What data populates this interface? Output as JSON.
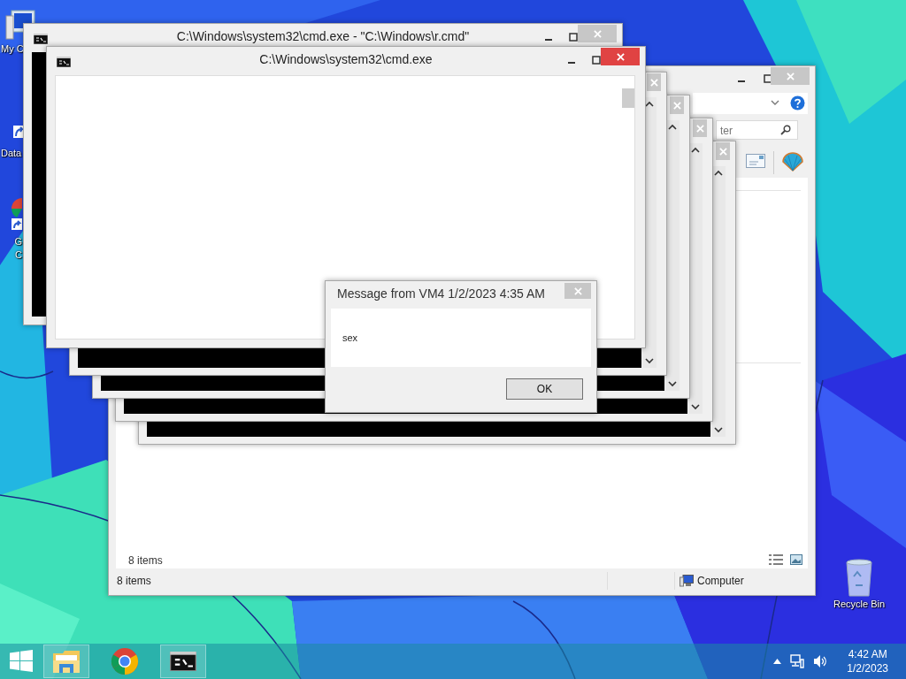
{
  "desktop_icons": [
    {
      "kind": "computer",
      "lines": [
        "My C"
      ]
    },
    {
      "kind": "shortcut",
      "lines": [
        "Data"
      ]
    },
    {
      "kind": "chrome",
      "lines": [
        "G",
        "C"
      ]
    },
    {
      "kind": "recycle",
      "lines": [
        "Recycle Bin"
      ]
    }
  ],
  "explorer": {
    "search": {
      "placeholder": "ter"
    },
    "content_status": "8 items",
    "status_bar": {
      "items": "8 items",
      "location": "Computer"
    }
  },
  "cmd_windows": [
    {
      "title": "C:\\Windows\\system32\\cmd.exe - \"C:\\Windows\\r.cmd\"",
      "active": false
    },
    {
      "title": "C:\\Windows\\system32\\cmd.exe",
      "active": true
    }
  ],
  "dialog": {
    "title": "Message from VM4 1/2/2023 4:35 AM",
    "message": "sex",
    "buttons": [
      "OK"
    ]
  },
  "taskbar": {
    "apps": [
      {
        "kind": "explorer",
        "running": true
      },
      {
        "kind": "chrome",
        "running": false
      },
      {
        "kind": "cmd",
        "running": true
      }
    ],
    "clock": {
      "time": "4:42 AM",
      "date": "1/2/2023"
    }
  }
}
